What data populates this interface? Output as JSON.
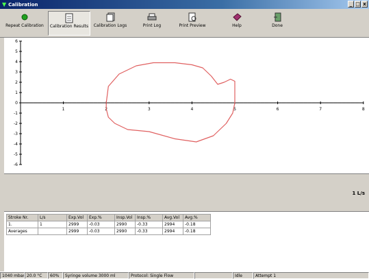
{
  "window": {
    "title": "Calibration",
    "minimize": "_",
    "maximize": "□",
    "close": "x"
  },
  "toolbar": {
    "repeat": "Repeat Calibration",
    "results": "Calibration Results",
    "logs": "Calibration Logs",
    "print_log": "Print Log",
    "print_preview": "Print Preview",
    "help": "Help",
    "done": "Done"
  },
  "chart_data": {
    "type": "line",
    "xlim": [
      0,
      8
    ],
    "ylim": [
      -6,
      6
    ],
    "x_ticks": [
      "1",
      "2",
      "3",
      "4",
      "5",
      "6",
      "7",
      "8"
    ],
    "y_ticks": [
      "6",
      "5",
      "4",
      "3",
      "2",
      "1",
      "0",
      "-1",
      "-2",
      "-3",
      "-4",
      "-5",
      "-6"
    ],
    "grid": false,
    "series_color": "#e06060",
    "loop": [
      [
        2.0,
        0.0
      ],
      [
        2.05,
        1.6
      ],
      [
        2.3,
        2.8
      ],
      [
        2.7,
        3.6
      ],
      [
        3.1,
        3.9
      ],
      [
        3.6,
        3.9
      ],
      [
        4.0,
        3.7
      ],
      [
        4.25,
        3.4
      ],
      [
        4.45,
        2.6
      ],
      [
        4.6,
        1.8
      ],
      [
        4.75,
        2.0
      ],
      [
        4.9,
        2.3
      ],
      [
        5.0,
        2.1
      ],
      [
        5.0,
        1.2
      ],
      [
        5.0,
        0.0
      ],
      [
        4.95,
        -1.0
      ],
      [
        4.8,
        -2.0
      ],
      [
        4.5,
        -3.2
      ],
      [
        4.1,
        -3.8
      ],
      [
        3.6,
        -3.5
      ],
      [
        3.0,
        -2.8
      ],
      [
        2.5,
        -2.6
      ],
      [
        2.2,
        -2.0
      ],
      [
        2.05,
        -1.4
      ],
      [
        2.0,
        -0.6
      ],
      [
        2.0,
        0.0
      ]
    ]
  },
  "unit_label": "1 L/s",
  "table": {
    "headers": [
      "Stroke Nr.",
      "L/s",
      "Exp.Vol",
      "Exp.%",
      "Insp.Vol",
      "Insp.%",
      "Avg.Vol",
      "Avg.%"
    ],
    "rows": [
      [
        "1.",
        "1",
        "2999",
        "-0.03",
        "2990",
        "-0.33",
        "2994",
        "-0.18"
      ],
      [
        "Averages",
        "",
        "2999",
        "-0.03",
        "2990",
        "-0.33",
        "2994",
        "-0.18"
      ]
    ]
  },
  "status": {
    "pressure": "1040 mbar",
    "temp": "20.0 °C",
    "humidity": "60%",
    "syringe": "Syringe volume 3000 ml",
    "protocol": "Protocol: Single Flow",
    "blank": "",
    "state": "Idle",
    "attempt": "Attempt 1"
  }
}
